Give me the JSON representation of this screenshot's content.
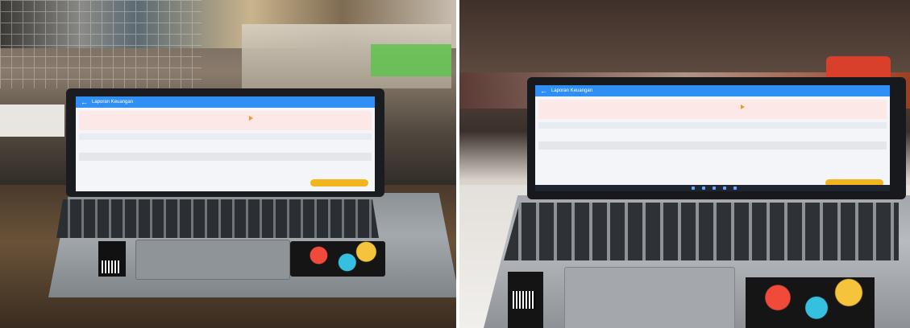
{
  "app": {
    "header_title": "Laporan Keuangan",
    "back_glyph": "←"
  },
  "icons": {
    "back": "arrow-left-icon",
    "play": "play-icon",
    "calendar": "calendar-icon"
  },
  "colors": {
    "header": "#2f8ff5",
    "summary_bg": "#fde8e8",
    "fab": "#f2b51d"
  }
}
